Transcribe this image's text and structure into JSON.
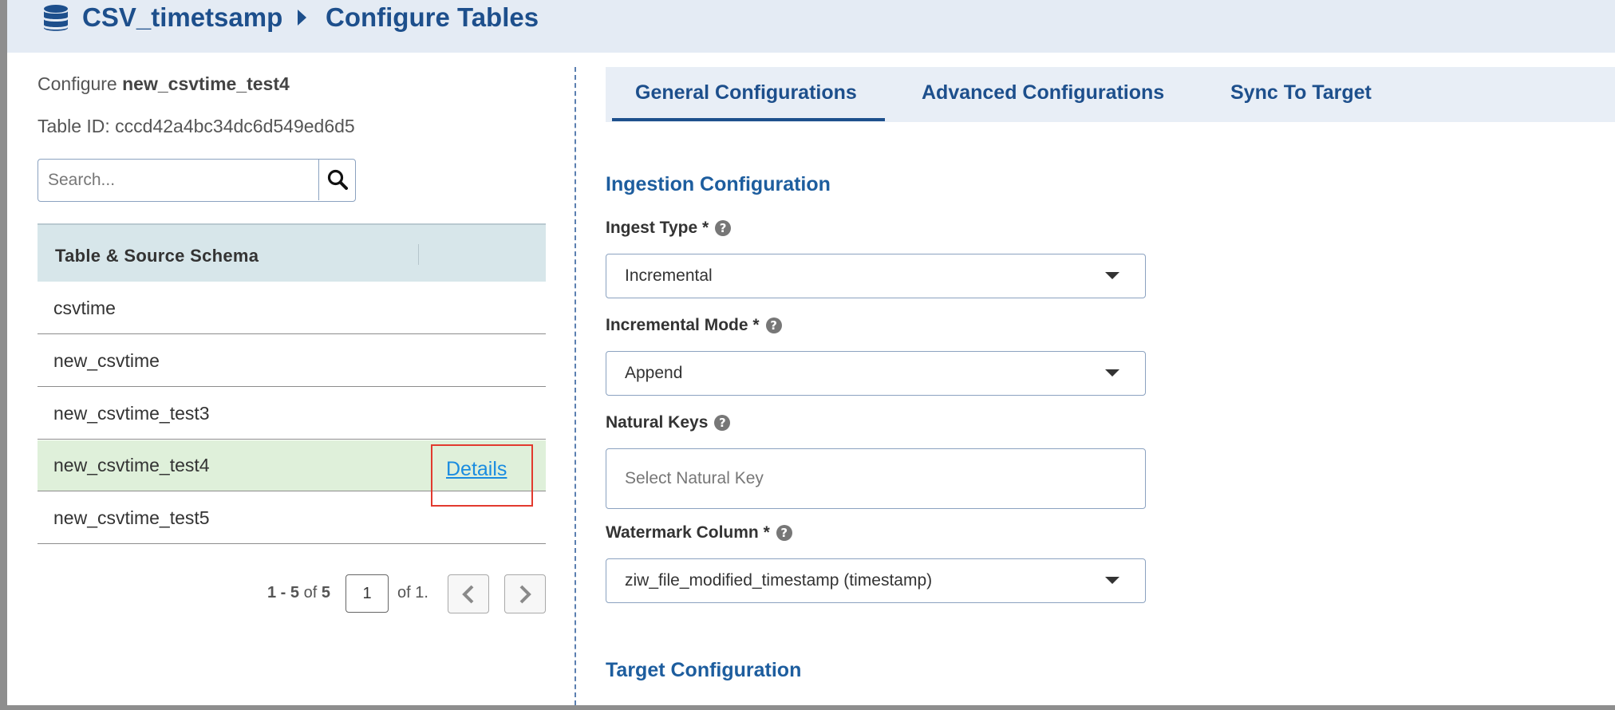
{
  "header": {
    "app_title": "CSV_timetsamp",
    "page_title": "Configure Tables",
    "icons": {
      "app": "database-icon",
      "separator": "caret-right-icon"
    }
  },
  "left_panel": {
    "configure_prefix": "Configure ",
    "table_name": "new_csvtime_test4",
    "table_id_label": "Table ID: cccd42a4bc34dc6d549ed6d5",
    "search": {
      "placeholder": "Search...",
      "value": "",
      "icon": "search-icon"
    },
    "table": {
      "column_header": "Table & Source Schema",
      "rows": [
        {
          "label": "csvtime"
        },
        {
          "label": "new_csvtime"
        },
        {
          "label": "new_csvtime_test3"
        },
        {
          "label": "new_csvtime_test4",
          "selected": true,
          "action": "Details"
        },
        {
          "label": "new_csvtime_test5"
        }
      ]
    },
    "pagination": {
      "range": "1 - 5",
      "of_word": "of",
      "total": "5",
      "page_value": "1",
      "pages_text": "of 1.",
      "prev_icon": "chevron-left-icon",
      "next_icon": "chevron-right-icon"
    }
  },
  "right_panel": {
    "tabs": [
      {
        "label": "General Configurations",
        "active": true
      },
      {
        "label": "Advanced Configurations",
        "active": false
      },
      {
        "label": "Sync To Target",
        "active": false
      }
    ],
    "ingestion_section_title": "Ingestion Configuration",
    "fields": {
      "ingest_type": {
        "label": "Ingest Type *",
        "value": "Incremental"
      },
      "incremental_mode": {
        "label": "Incremental Mode *",
        "value": "Append"
      },
      "natural_keys": {
        "label": "Natural Keys",
        "placeholder": "Select Natural Key"
      },
      "watermark_column": {
        "label": "Watermark Column *",
        "value": "ziw_file_modified_timestamp (timestamp)"
      }
    },
    "help_glyph": "?",
    "target_section_title": "Target Configuration"
  },
  "colors": {
    "brand": "#1d4f8c",
    "header_bg": "#e4ebf4",
    "table_header_bg": "#d7e6ea",
    "selected_row_bg": "#dff0da",
    "link": "#1a8ce0",
    "highlight": "#e23a2e"
  }
}
